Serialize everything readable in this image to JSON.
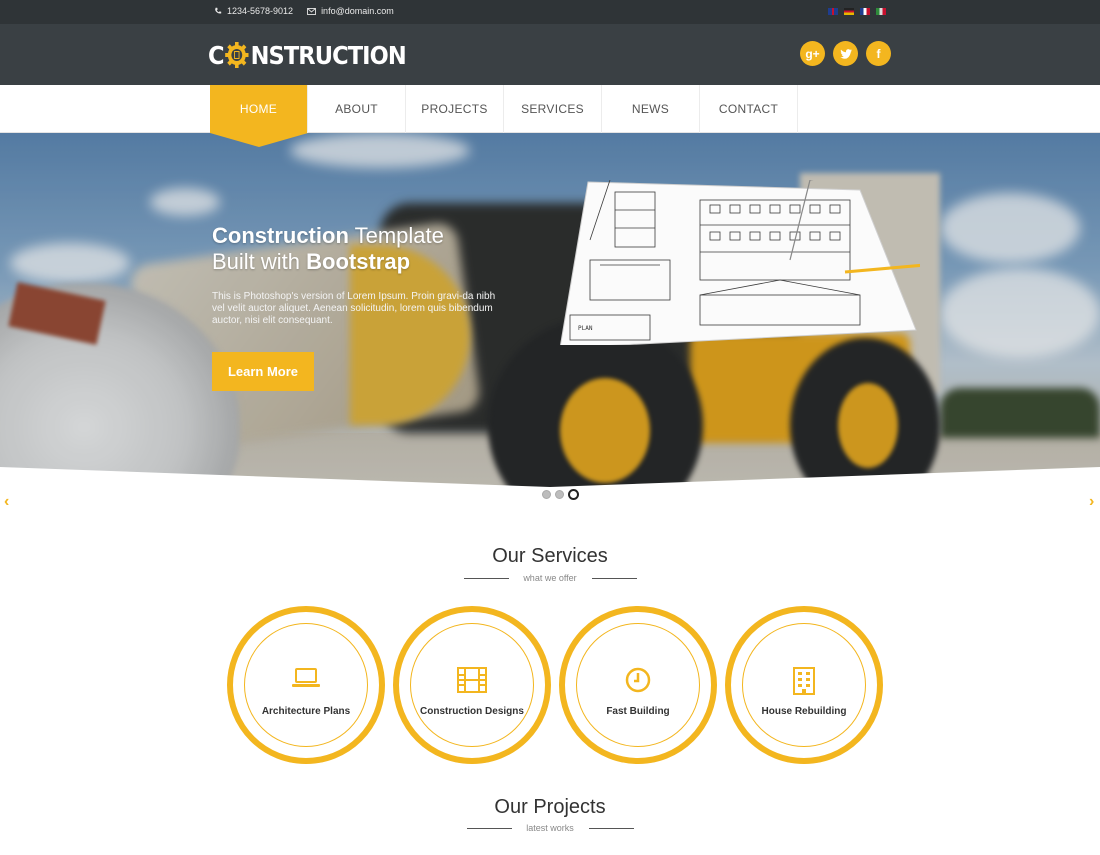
{
  "topbar": {
    "phone": "1234-5678-9012",
    "email": "info@domain.com",
    "phone_icon": "phone-icon",
    "email_icon": "envelope-icon"
  },
  "header": {
    "logo_prefix": "C",
    "logo_suffix": "NSTRUCTION",
    "social": [
      {
        "icon": "google-plus-icon",
        "glyph": "g+"
      },
      {
        "icon": "twitter-icon",
        "glyph": "t"
      },
      {
        "icon": "facebook-icon",
        "glyph": "f"
      }
    ]
  },
  "nav": {
    "items": [
      "HOME",
      "ABOUT",
      "PROJECTS",
      "SERVICES",
      "NEWS",
      "CONTACT"
    ],
    "active": "HOME"
  },
  "hero": {
    "title_line1_bold": "Construction",
    "title_line1_rest": " Template",
    "title_line2_pre": "Built with ",
    "title_line2_bold": "Bootstrap",
    "description": "This is Photoshop's version of Lorem Ipsum. Proin gravi-da nibh vel velit auctor aliquet. Aenean solicitudin, lorem quis bibendum auctor, nisi elit consequant.",
    "button": "Learn More",
    "slides": 3,
    "active_slide": 3
  },
  "services": {
    "title": "Our Services",
    "subtitle": "what we offer",
    "items": [
      {
        "label": "Architecture Plans",
        "icon": "laptop-icon"
      },
      {
        "label": "Construction Designs",
        "icon": "film-icon"
      },
      {
        "label": "Fast Building",
        "icon": "clock-icon"
      },
      {
        "label": "House Rebuilding",
        "icon": "building-icon"
      }
    ]
  },
  "projects": {
    "title": "Our Projects",
    "subtitle": "latest works"
  },
  "colors": {
    "accent": "#f3b61f",
    "topbar": "#2f3437",
    "header": "#3a4044"
  }
}
